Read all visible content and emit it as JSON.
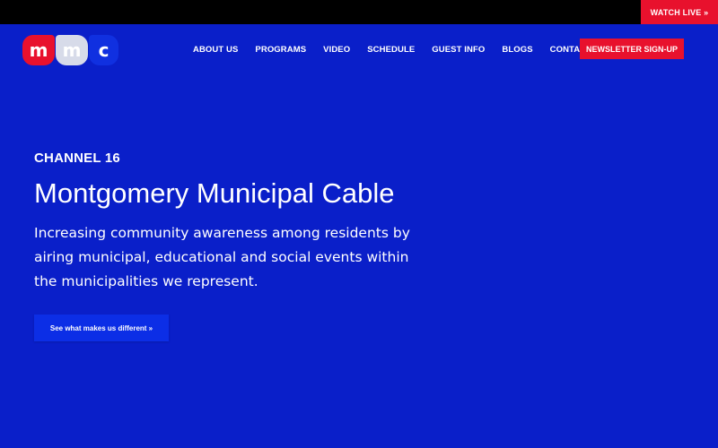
{
  "topbar": {
    "watch_live": "WATCH LIVE »"
  },
  "logo": {
    "letters": [
      "m",
      "m",
      "c"
    ]
  },
  "nav": {
    "items": [
      "ABOUT US",
      "PROGRAMS",
      "VIDEO",
      "SCHEDULE",
      "GUEST INFO",
      "BLOGS",
      "CONTACT"
    ],
    "newsletter": "NEWSLETTER SIGN-UP"
  },
  "hero": {
    "eyebrow": "CHANNEL 16",
    "title": "Montgomery Municipal Cable",
    "description": "Increasing community awareness among residents by airing municipal, educational and social events within the municipalities we represent.",
    "cta": "See what makes us different »"
  },
  "colors": {
    "background": "#0a1fc9",
    "accent": "#e8112d",
    "topbar": "#000000",
    "button": "#0c2ee6"
  }
}
